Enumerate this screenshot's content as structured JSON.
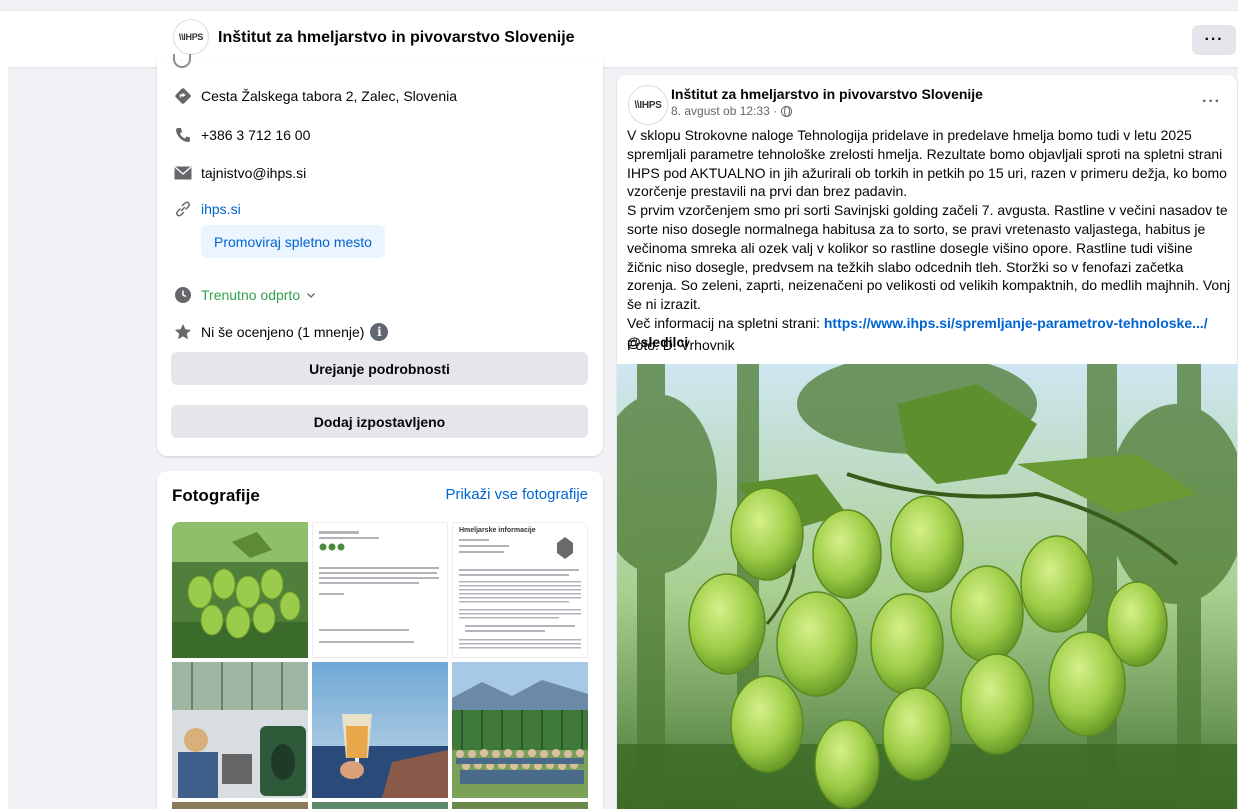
{
  "page": {
    "logo_text": "\\\\IHPS",
    "title": "Inštitut za hmeljarstvo in pivovarstvo Slovenije",
    "more_label": "···"
  },
  "intro": {
    "address": "Cesta Žalskega tabora 2, Zalec, Slovenia",
    "phone": "+386 3 712 16 00",
    "email": "tajnistvo@ihps.si",
    "website": "ihps.si",
    "promote_button": "Promoviraj spletno mesto",
    "hours": "Trenutno odprto",
    "rating": "Ni še ocenjeno (1 mnenje)",
    "edit_button": "Urejanje podrobnosti",
    "featured_button": "Dodaj izpostavljeno"
  },
  "photos": {
    "title": "Fotografije",
    "see_all": "Prikaži vse fotografije",
    "doc_title": "Hmeljarske informacije"
  },
  "post": {
    "author": "Inštitut za hmeljarstvo in pivovarstvo Slovenije",
    "timestamp": "8. avgust ob 12:33 ·",
    "more_label": "···",
    "paragraph1": "V sklopu Strokovne naloge Tehnologija pridelave in predelave hmelja bomo tudi v letu 2025 spremljali parametre tehnološke zrelosti hmelja. Rezultate bomo objavljali sproti na spletni strani IHPS pod AKTUALNO in jih ažurirali ob torkih in petkih po 15 uri, razen v primeru dežja, ko bomo vzorčenje prestavili na prvi dan brez padavin.",
    "paragraph2": "S prvim vzorčenjem smo pri sorti Savinjski golding začeli 7. avgusta. Rastline v večini nasadov te sorte niso dosegle normalnega habitusa za to sorto, se pravi vretenasto valjastega, habitus je večinoma smreka ali ozek valj v kolikor so rastline dosegle višino opore. Rastline tudi višine žičnic niso dosegle, predvsem na težkih slabo odcednih tleh. Storžki so v fenofazi začetka zorenja. So zeleni, zaprti, neizenačeni po velikosti od velikih kompaktnih, do medlih majhnih. Vonj še ni izrazit.",
    "more_info_prefix": "Več informacij na spletni strani: ",
    "link": "https://www.ihps.si/spremljanje-parametrov-tehnoloske.../",
    "mention": "@sledilci",
    "photo_credit": "Foto: D. Vrhovnik"
  }
}
